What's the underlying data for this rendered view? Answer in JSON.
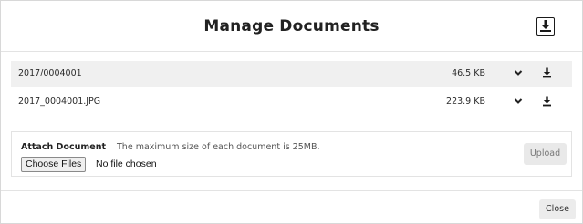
{
  "dialog": {
    "title": "Manage Documents",
    "header_icon": "download-all-icon"
  },
  "documents": [
    {
      "name": "2017/0004001",
      "size": "46.5 KB",
      "expand_icon": "chevron-down-icon",
      "download_icon": "download-icon"
    },
    {
      "name": "2017_0004001.JPG",
      "size": "223.9 KB",
      "expand_icon": "chevron-down-icon",
      "download_icon": "download-icon"
    }
  ],
  "attach": {
    "label": "Attach Document",
    "hint": "The maximum size of each document is 25MB.",
    "choose_files_label": "Choose Files",
    "file_status": "No file chosen",
    "upload_label": "Upload"
  },
  "footer": {
    "close_label": "Close"
  },
  "colors": {
    "row_shade": "#f0f0f0",
    "border": "#e3e3e3",
    "button_bg": "#e9e9e9",
    "icon": "#1a1a1a"
  }
}
